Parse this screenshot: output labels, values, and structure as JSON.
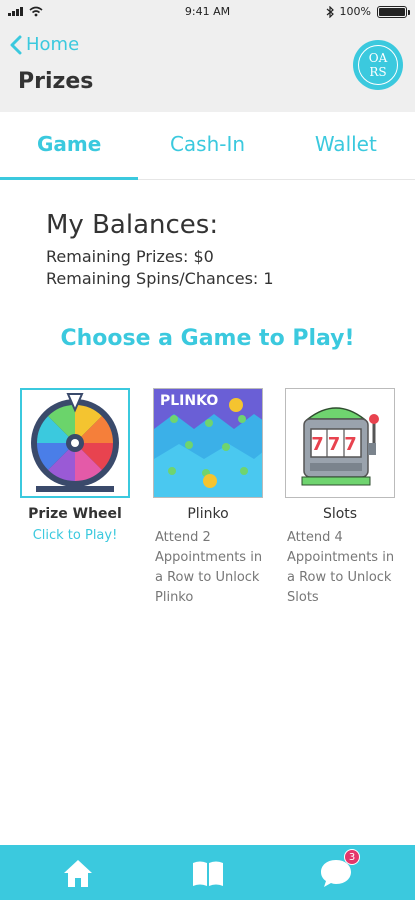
{
  "status_bar": {
    "time": "9:41 AM",
    "battery": "100%",
    "battery_level": 1.0
  },
  "header": {
    "back_label": "Home",
    "title": "Prizes",
    "logo_text_top": "OA",
    "logo_text_bottom": "RS"
  },
  "tabs": [
    {
      "label": "Game",
      "active": true
    },
    {
      "label": "Cash-In",
      "active": false
    },
    {
      "label": "Wallet",
      "active": false
    }
  ],
  "balances": {
    "title": "My Balances:",
    "remaining_prizes": "Remaining Prizes: $0",
    "remaining_spins": "Remaining Spins/Chances: 1"
  },
  "choose_heading": "Choose a Game to Play!",
  "games": [
    {
      "name": "Prize Wheel",
      "cta": "Click to Play!",
      "icon": "prize-wheel-icon"
    },
    {
      "name": "Plinko",
      "note": "Attend 2 Appointments in a Row to Unlock Plinko",
      "icon": "plinko-icon",
      "thumb_text": "PLINKO"
    },
    {
      "name": "Slots",
      "note": "Attend 4 Appointments in a Row to Unlock Slots",
      "icon": "slot-machine-icon",
      "thumb_text": "777"
    }
  ],
  "bottom_nav": {
    "items": [
      "home-icon",
      "book-icon",
      "chat-icon"
    ],
    "chat_badge": "3"
  },
  "colors": {
    "accent": "#3bc9de",
    "badge": "#e4366b",
    "header_bg": "#efefef"
  }
}
